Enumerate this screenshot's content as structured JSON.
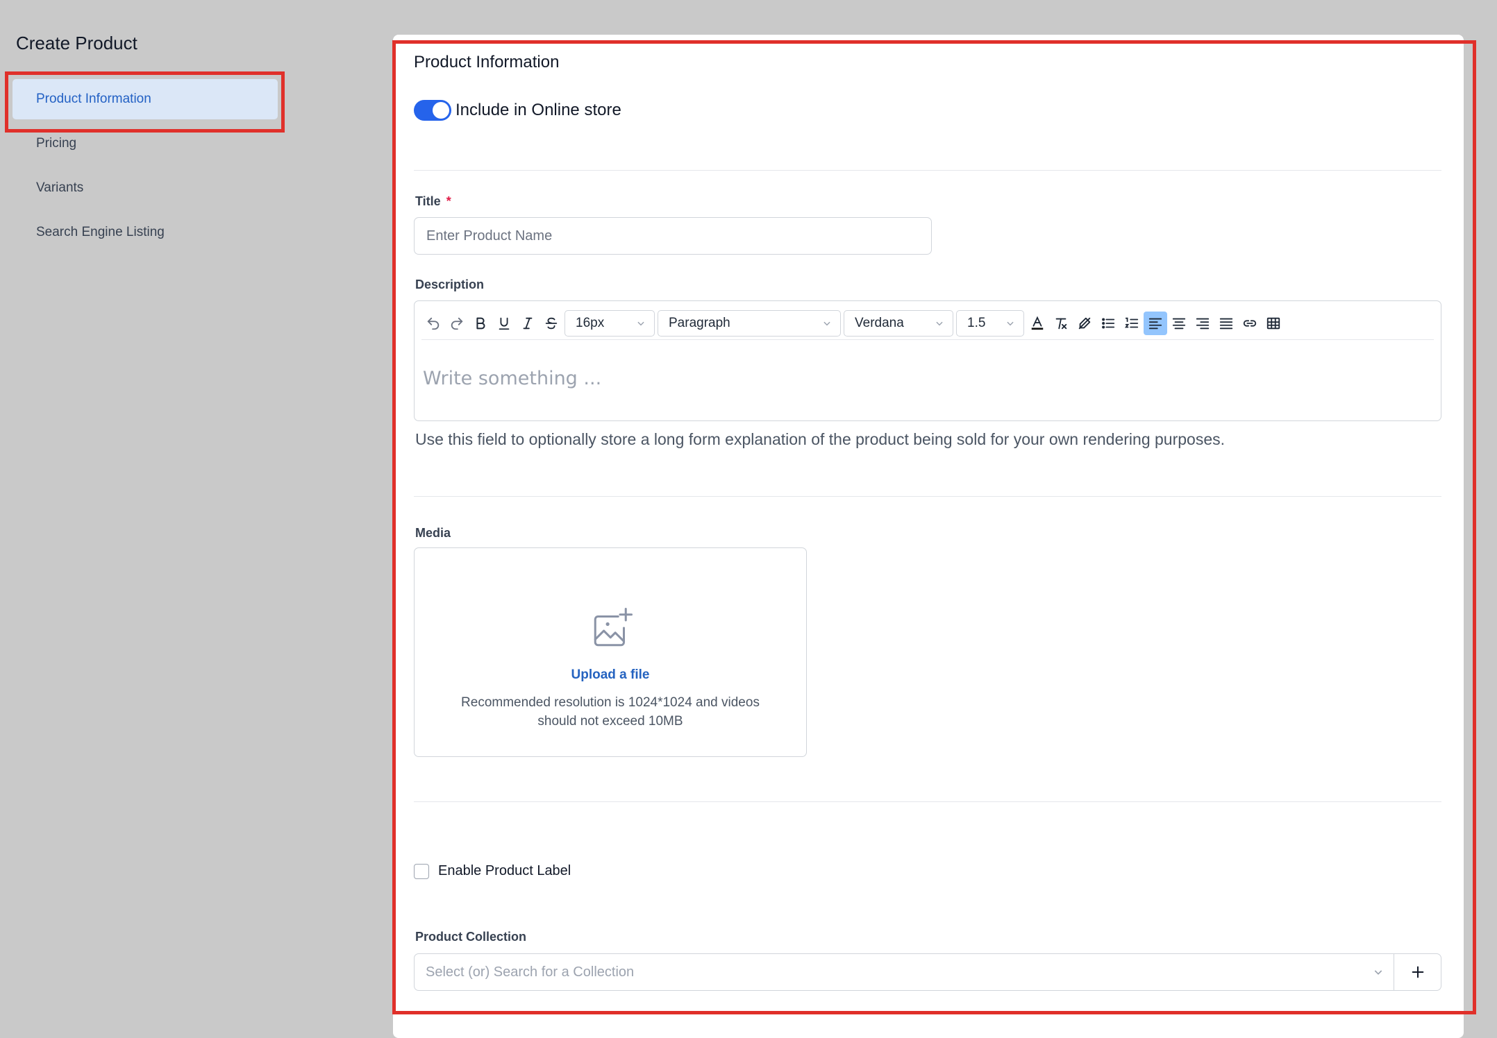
{
  "app": {
    "title": "Create Product"
  },
  "sidebar": {
    "items": [
      {
        "label": "Product Information",
        "active": true
      },
      {
        "label": "Pricing",
        "active": false
      },
      {
        "label": "Variants",
        "active": false
      },
      {
        "label": "Search Engine Listing",
        "active": false
      }
    ]
  },
  "section": {
    "title": "Product Information",
    "online_store_toggle": {
      "label": "Include in Online store",
      "on": true
    }
  },
  "title_field": {
    "label": "Title",
    "required_mark": "*",
    "placeholder": "Enter Product Name",
    "value": ""
  },
  "description": {
    "label": "Description",
    "toolbar": {
      "font_size": "16px",
      "block_format": "Paragraph",
      "font_family": "Verdana",
      "line_height": "1.5",
      "tools": [
        "undo-icon",
        "redo-icon",
        "bold-icon",
        "underline-icon",
        "italic-icon",
        "strikethrough-icon",
        "text-color-icon",
        "clear-format-icon",
        "highlight-clear-icon",
        "bullet-list-icon",
        "numbered-list-icon",
        "align-left-icon",
        "align-center-icon",
        "align-right-icon",
        "align-justify-icon",
        "link-icon",
        "table-icon"
      ],
      "active_tool": "align-left-icon"
    },
    "placeholder": "Write something ...",
    "help_text": "Use this field to optionally store a long form explanation of the product being sold for your own rendering purposes."
  },
  "media": {
    "label": "Media",
    "icon": "image-add-icon",
    "upload_link": "Upload a file",
    "hint": "Recommended resolution is 1024*1024 and videos should not exceed 10MB"
  },
  "product_label": {
    "label": "Enable Product Label",
    "checked": false
  },
  "collection": {
    "label": "Product Collection",
    "placeholder": "Select (or) Search for a Collection",
    "add_icon": "plus-icon"
  },
  "colors": {
    "accent": "#2563eb",
    "highlight_border": "#e0302a",
    "active_nav_bg": "#dbe7f7",
    "page_bg": "#c9c9c9"
  }
}
